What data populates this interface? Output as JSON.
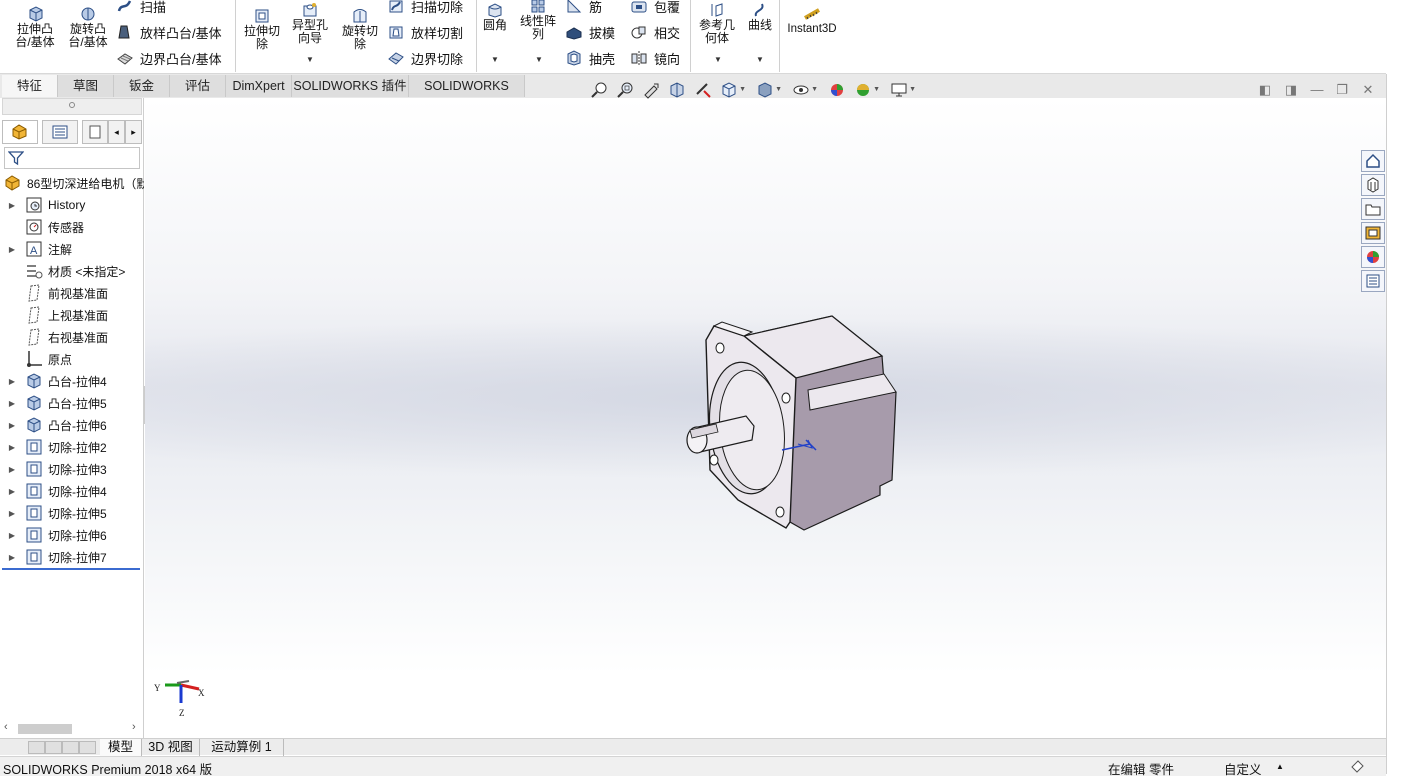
{
  "ribbon": {
    "extrude_boss": "拉伸凸\n台/基体",
    "revolve_boss": "旋转凸\n台/基体",
    "sweep": "扫描",
    "loft_boss": "放样凸台/基体",
    "boundary_boss": "边界凸台/基体",
    "extrude_cut": "拉伸切\n除",
    "hole_wizard": "异型孔\n向导",
    "revolve_cut": "旋转切\n除",
    "swept_cut": "扫描切除",
    "lofted_cut": "放样切割",
    "boundary_cut": "边界切除",
    "fillet": "圆角",
    "linear_pattern": "线性阵\n列",
    "rib": "筋",
    "draft": "拔模",
    "shell": "抽壳",
    "wrap": "包覆",
    "intersect": "相交",
    "mirror": "镜向",
    "ref_geometry": "参考几\n何体",
    "curves": "曲线",
    "instant3d": "Instant3D"
  },
  "command_tabs": [
    "特征",
    "草图",
    "钣金",
    "评估",
    "DimXpert",
    "SOLIDWORKS 插件",
    "SOLIDWORKS MBD"
  ],
  "active_command_tab": "特征",
  "feature_tree": {
    "part_name": "86型切深进给电机（默",
    "items": [
      {
        "label": "History",
        "icon": "history-icon",
        "expandable": true
      },
      {
        "label": "传感器",
        "icon": "sensor-icon",
        "expandable": false
      },
      {
        "label": "注解",
        "icon": "annotation-icon",
        "expandable": true
      },
      {
        "label": "材质 <未指定>",
        "icon": "material-icon",
        "expandable": false
      },
      {
        "label": "前视基准面",
        "icon": "plane-icon",
        "expandable": false
      },
      {
        "label": "上视基准面",
        "icon": "plane-icon",
        "expandable": false
      },
      {
        "label": "右视基准面",
        "icon": "plane-icon",
        "expandable": false
      },
      {
        "label": "原点",
        "icon": "origin-icon",
        "expandable": false
      },
      {
        "label": "凸台-拉伸4",
        "icon": "boss-extrude-icon",
        "expandable": true
      },
      {
        "label": "凸台-拉伸5",
        "icon": "boss-extrude-icon",
        "expandable": true
      },
      {
        "label": "凸台-拉伸6",
        "icon": "boss-extrude-icon",
        "expandable": true
      },
      {
        "label": "切除-拉伸2",
        "icon": "cut-extrude-icon",
        "expandable": true
      },
      {
        "label": "切除-拉伸3",
        "icon": "cut-extrude-icon",
        "expandable": true
      },
      {
        "label": "切除-拉伸4",
        "icon": "cut-extrude-icon",
        "expandable": true
      },
      {
        "label": "切除-拉伸5",
        "icon": "cut-extrude-icon",
        "expandable": true
      },
      {
        "label": "切除-拉伸6",
        "icon": "cut-extrude-icon",
        "expandable": true
      },
      {
        "label": "切除-拉伸7",
        "icon": "cut-extrude-icon",
        "expandable": true
      }
    ]
  },
  "triad": {
    "x": "X",
    "y": "Y",
    "z": "Z"
  },
  "bottom_tabs": [
    "模型",
    "3D 视图",
    "运动算例 1"
  ],
  "active_bottom_tab": "模型",
  "status_bar": {
    "app": "SOLIDWORKS Premium 2018 x64 版",
    "mode": "在编辑 零件",
    "units": "自定义",
    "caret": "▲"
  },
  "colors": {
    "model_face": "#ede9ef",
    "model_side": "#a79bab",
    "accent_blue": "#3b6bd0"
  }
}
